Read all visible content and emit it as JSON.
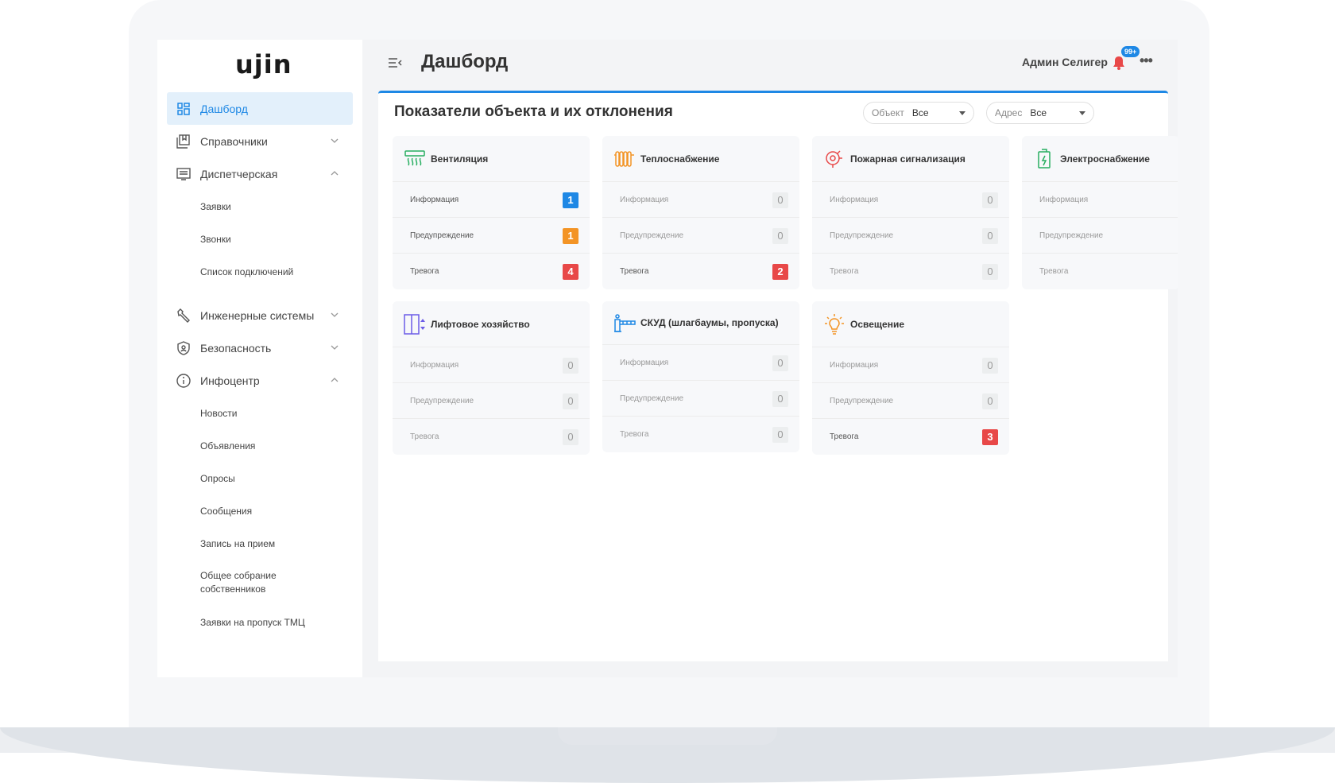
{
  "app": {
    "logo": "ujin"
  },
  "sidebar": {
    "items": [
      {
        "label": "Дашборд",
        "active": true
      },
      {
        "label": "Справочники"
      },
      {
        "label": "Диспетчерская",
        "expanded": true,
        "children": [
          "Заявки",
          "Звонки",
          "Список подключений"
        ]
      },
      {
        "label": "Инженерные системы"
      },
      {
        "label": "Безопасность"
      },
      {
        "label": "Инфоцентр",
        "expanded": true,
        "children": [
          "Новости",
          "Объявления",
          "Опросы",
          "Сообщения",
          "Запись на прием",
          "Общее собрание собственников",
          "Заявки на пропуск ТМЦ"
        ]
      }
    ]
  },
  "header": {
    "title": "Дашборд",
    "user": "Админ Селигер",
    "notifications_badge": "99+"
  },
  "section": {
    "title": "Показатели объекта и их отклонения",
    "filters": [
      {
        "label": "Объект",
        "value": "Все"
      },
      {
        "label": "Адрес",
        "value": "Все"
      }
    ]
  },
  "row_labels": [
    "Информация",
    "Предупреждение",
    "Тревога"
  ],
  "cards": [
    {
      "title": "Вентиляция",
      "icon": "ventilation-icon",
      "color": "#27ae60",
      "values": [
        "1",
        "1",
        "4"
      ]
    },
    {
      "title": "Теплоснабжение",
      "icon": "radiator-icon",
      "color": "#f39425",
      "values": [
        "0",
        "0",
        "2"
      ]
    },
    {
      "title": "Пожарная сигнализация",
      "icon": "fire-alarm-icon",
      "color": "#e84848",
      "values": [
        "0",
        "0",
        "0"
      ]
    },
    {
      "title": "Электроснабжение",
      "icon": "battery-icon",
      "color": "#27ae60",
      "values": [
        "",
        "",
        ""
      ]
    },
    {
      "title": "Лифтовое хозяйство",
      "icon": "elevator-icon",
      "color": "#6c5ce7",
      "values": [
        "0",
        "0",
        "0"
      ]
    },
    {
      "title": "СКУД (шлагбаумы, пропуска)",
      "icon": "barrier-icon",
      "color": "#1e88e5",
      "values": [
        "0",
        "0",
        "0"
      ]
    },
    {
      "title": "Освещение",
      "icon": "lightbulb-icon",
      "color": "#f39425",
      "values": [
        "0",
        "0",
        "3"
      ]
    }
  ],
  "colors": {
    "accent": "#1e88e5",
    "info": "#1e88e5",
    "warning": "#f39425",
    "alarm": "#e84848"
  }
}
